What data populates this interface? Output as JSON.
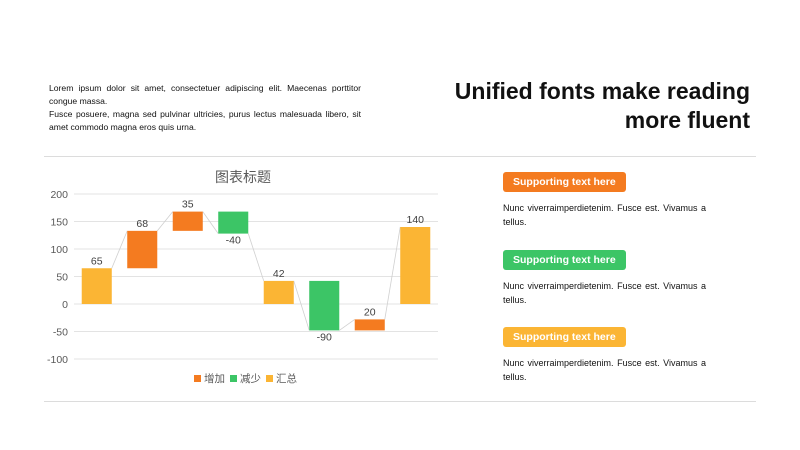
{
  "intro": {
    "line1": "Lorem ipsum dolor sit amet, consectetuer adipiscing elit. Maecenas porttitor congue massa.",
    "line2": "Fusce posuere, magna sed pulvinar ultricies, purus lectus malesuada libero, sit amet commodo magna eros quis urna."
  },
  "headline": {
    "line1": "Unified fonts make reading",
    "line2": "more fluent"
  },
  "chart_data": {
    "type": "bar",
    "subtype": "waterfall",
    "title": "图表标题",
    "xlabel": "",
    "ylabel": "",
    "ylim": [
      -100,
      200
    ],
    "yticks": [
      -100,
      -50,
      0,
      50,
      100,
      150,
      200
    ],
    "grid": true,
    "legend_position": "bottom",
    "legend": [
      {
        "name": "增加",
        "color": "#F47B20"
      },
      {
        "name": "减少",
        "color": "#3CC566"
      },
      {
        "name": "汇总",
        "color": "#FBB534"
      }
    ],
    "bars": [
      {
        "kind": "汇总",
        "value": 65,
        "start": 0,
        "end": 65
      },
      {
        "kind": "增加",
        "value": 68,
        "start": 65,
        "end": 133
      },
      {
        "kind": "增加",
        "value": 35,
        "start": 133,
        "end": 168
      },
      {
        "kind": "减少",
        "value": -40,
        "start": 168,
        "end": 128
      },
      {
        "kind": "汇总",
        "value": 42,
        "start": 0,
        "end": 42
      },
      {
        "kind": "减少",
        "value": -90,
        "start": 42,
        "end": -48
      },
      {
        "kind": "增加",
        "value": 20,
        "start": -48,
        "end": -28
      },
      {
        "kind": "汇总",
        "value": 140,
        "start": 0,
        "end": 140
      }
    ]
  },
  "side": [
    {
      "badge": "Supporting text here",
      "color": "#F47B20",
      "text": "Nunc viverraimperdietenim. Fusce est. Vivamus a tellus."
    },
    {
      "badge": "Supporting text here",
      "color": "#3CC566",
      "text": "Nunc viverraimperdietenim. Fusce est. Vivamus a tellus."
    },
    {
      "badge": "Supporting text here",
      "color": "#FBB534",
      "text": "Nunc viverraimperdietenim. Fusce est. Vivamus a tellus."
    }
  ]
}
